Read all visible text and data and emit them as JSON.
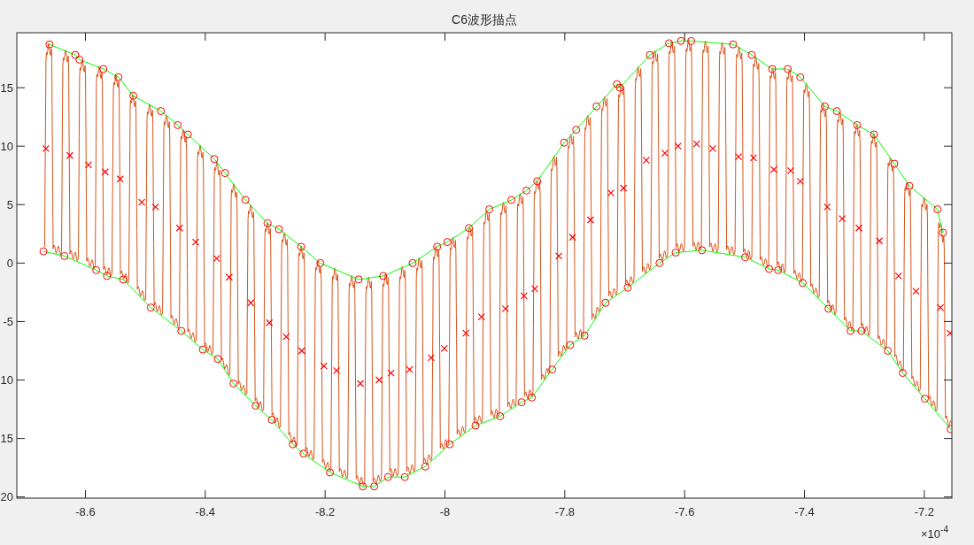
{
  "figure": {
    "title": "C6波形描点",
    "chart_data": {
      "type": "line",
      "xlim": [
        -8.7145,
        -7.154
      ],
      "ylim": [
        -20.1,
        19.7
      ],
      "xticks": [
        -8.6,
        -8.4,
        -8.2,
        -8,
        -7.8,
        -7.6,
        -7.4,
        -7.2
      ],
      "yticks": [
        15,
        10,
        5,
        0,
        -5,
        {
          "value": -10,
          "label": "10"
        },
        {
          "value": -15,
          "label": "15"
        },
        {
          "value": -20,
          "label": "20"
        }
      ],
      "annotations": [
        {
          "text": "×10$^{-4}$"
        }
      ],
      "series": [
        {
          "type": "line",
          "color": "#00ff00",
          "marker": "none",
          "x": [
            -8.66,
            -8.617,
            -8.61,
            -8.57,
            -8.545,
            -8.52,
            -8.474,
            -8.446,
            -8.429,
            -8.385,
            -8.367,
            -8.333,
            -8.296,
            -8.277,
            -8.24,
            -8.208,
            -8.144,
            -8.103,
            -8.054,
            -8.013,
            -7.996,
            -7.96,
            -7.926,
            -7.889,
            -7.864,
            -7.846,
            -7.801,
            -7.781,
            -7.747,
            -7.713,
            -7.708,
            -7.658,
            -7.626,
            -7.606,
            -7.589,
            -7.519,
            -7.488,
            -7.454,
            -7.428,
            -7.407,
            -7.366,
            -7.346,
            -7.312,
            -7.284,
            -7.25,
            -7.225,
            -7.178,
            -7.169
          ],
          "values": [
            18.7,
            17.8,
            17.4,
            16.6,
            15.9,
            14.3,
            13.0,
            11.8,
            11.0,
            8.9,
            7.7,
            5.4,
            3.4,
            2.9,
            1.4,
            0,
            -1.4,
            -1.1,
            0,
            1.4,
            1.8,
            3.0,
            4.6,
            5.4,
            6.2,
            7.0,
            10.3,
            11.4,
            13.4,
            15.3,
            15.0,
            17.8,
            18.8,
            19.0,
            19.0,
            18.7,
            17.8,
            16.6,
            16.6,
            15.9,
            13.4,
            13.0,
            11.8,
            11.0,
            8.5,
            6.6,
            4.6,
            2.6
          ]
        },
        {
          "type": "line",
          "color": "#00ff00",
          "marker": "none",
          "x": [
            -8.67,
            -8.635,
            -8.582,
            -8.564,
            -8.537,
            -8.491,
            -8.44,
            -8.404,
            -8.379,
            -8.353,
            -8.316,
            -8.289,
            -8.254,
            -8.236,
            -8.192,
            -8.137,
            -8.118,
            -8.095,
            -8.067,
            -8.033,
            -7.992,
            -7.949,
            -7.908,
            -7.872,
            -7.855,
            -7.821,
            -7.791,
            -7.767,
            -7.732,
            -7.695,
            -7.642,
            -7.615,
            -7.571,
            -7.499,
            -7.459,
            -7.444,
            -7.403,
            -7.36,
            -7.323,
            -7.305,
            -7.261,
            -7.236,
            -7.199,
            -7.156
          ],
          "values": [
            1.0,
            0.6,
            -0.6,
            -1.1,
            -1.4,
            -3.8,
            -5.8,
            -7.4,
            -8.2,
            -10.3,
            -12.2,
            -13.4,
            -15.5,
            -16.3,
            -17.9,
            -19.1,
            -19.1,
            -18.3,
            -18.3,
            -17.4,
            -15.5,
            -13.9,
            -13.1,
            -11.9,
            -11.5,
            -9.1,
            -7.0,
            -6.2,
            -3.4,
            -2.1,
            0,
            0.9,
            1.1,
            0.5,
            -0.5,
            -0.6,
            -1.7,
            -3.9,
            -5.8,
            -5.8,
            -7.5,
            -9.4,
            -11.6,
            -14.2
          ]
        },
        {
          "type": "scatter",
          "color": "#ff0000",
          "marker": "circle",
          "x": [
            -8.66,
            -8.617,
            -8.61,
            -8.57,
            -8.545,
            -8.52,
            -8.474,
            -8.446,
            -8.429,
            -8.385,
            -8.367,
            -8.333,
            -8.296,
            -8.277,
            -8.24,
            -8.208,
            -8.144,
            -8.103,
            -8.054,
            -8.013,
            -7.996,
            -7.96,
            -7.926,
            -7.889,
            -7.864,
            -7.846,
            -7.801,
            -7.781,
            -7.747,
            -7.713,
            -7.708,
            -7.658,
            -7.626,
            -7.606,
            -7.589,
            -7.519,
            -7.488,
            -7.454,
            -7.428,
            -7.407,
            -7.366,
            -7.346,
            -7.312,
            -7.284,
            -7.25,
            -7.225,
            -7.178,
            -7.169
          ],
          "values": [
            18.7,
            17.8,
            17.4,
            16.6,
            15.9,
            14.3,
            13.0,
            11.8,
            11.0,
            8.9,
            7.7,
            5.4,
            3.4,
            2.9,
            1.4,
            0,
            -1.4,
            -1.1,
            0,
            1.4,
            1.8,
            3.0,
            4.6,
            5.4,
            6.2,
            7.0,
            10.3,
            11.4,
            13.4,
            15.3,
            15.0,
            17.8,
            18.8,
            19.0,
            19.0,
            18.7,
            17.8,
            16.6,
            16.6,
            15.9,
            13.4,
            13.0,
            11.8,
            11.0,
            8.5,
            6.6,
            4.6,
            2.6
          ]
        },
        {
          "type": "scatter",
          "color": "#ff0000",
          "marker": "circle",
          "x": [
            -8.67,
            -8.635,
            -8.582,
            -8.564,
            -8.537,
            -8.491,
            -8.44,
            -8.404,
            -8.379,
            -8.353,
            -8.316,
            -8.289,
            -8.254,
            -8.236,
            -8.192,
            -8.137,
            -8.118,
            -8.095,
            -8.067,
            -8.033,
            -7.992,
            -7.949,
            -7.908,
            -7.872,
            -7.855,
            -7.821,
            -7.791,
            -7.767,
            -7.732,
            -7.695,
            -7.642,
            -7.615,
            -7.571,
            -7.499,
            -7.459,
            -7.444,
            -7.403,
            -7.36,
            -7.323,
            -7.305,
            -7.261,
            -7.236,
            -7.199,
            -7.156
          ],
          "values": [
            1.0,
            0.6,
            -0.6,
            -1.1,
            -1.4,
            -3.8,
            -5.8,
            -7.4,
            -8.2,
            -10.3,
            -12.2,
            -13.4,
            -15.5,
            -16.3,
            -17.9,
            -19.1,
            -19.1,
            -18.3,
            -18.3,
            -17.4,
            -15.5,
            -13.9,
            -13.1,
            -11.9,
            -11.5,
            -9.1,
            -7.0,
            -6.2,
            -3.4,
            -2.1,
            0,
            0.9,
            1.1,
            0.5,
            -0.5,
            -0.6,
            -1.7,
            -3.9,
            -5.8,
            -5.8,
            -7.5,
            -9.4,
            -11.6,
            -14.2
          ]
        },
        {
          "type": "scatter",
          "color": "#ff0000",
          "marker": "cross",
          "x": [
            -8.666,
            -8.626,
            -8.595,
            -8.567,
            -8.542,
            -8.506,
            -8.483,
            -8.443,
            -8.416,
            -8.381,
            -8.36,
            -8.324,
            -8.293,
            -8.265,
            -8.239,
            -8.202,
            -8.181,
            -8.141,
            -8.11,
            -8.09,
            -8.059,
            -8.023,
            -8.001,
            -7.965,
            -7.939,
            -7.899,
            -7.868,
            -7.85,
            -7.81,
            -7.787,
            -7.757,
            -7.723,
            -7.702,
            -7.664,
            -7.633,
            -7.611,
            -7.58,
            -7.553,
            -7.51,
            -7.485,
            -7.451,
            -7.423,
            -7.407,
            -7.362,
            -7.337,
            -7.309,
            -7.275,
            -7.243,
            -7.214,
            -7.173,
            -7.157
          ],
          "values": [
            9.8,
            9.2,
            8.4,
            7.8,
            7.2,
            5.2,
            4.8,
            3.0,
            1.8,
            0.4,
            -1.2,
            -3.4,
            -5.1,
            -6.3,
            -7.5,
            -8.8,
            -9.2,
            -10.3,
            -10.0,
            -9.4,
            -9.1,
            -8.1,
            -7.3,
            -6.0,
            -4.6,
            -3.9,
            -2.8,
            -2.2,
            0.6,
            2.2,
            3.7,
            6.0,
            6.4,
            8.8,
            9.4,
            10.0,
            10.2,
            9.8,
            9.1,
            9.0,
            8.0,
            7.9,
            7.0,
            4.8,
            3.8,
            3.0,
            1.9,
            -1.1,
            -2.4,
            -3.8,
            -6.0
          ]
        }
      ]
    }
  }
}
